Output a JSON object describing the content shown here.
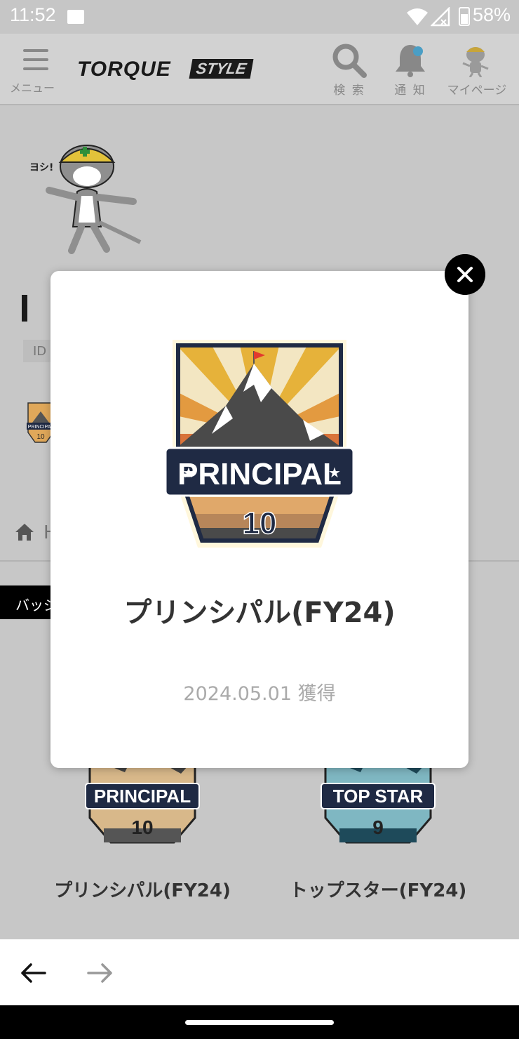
{
  "status_bar": {
    "time": "11:52",
    "battery": "58%"
  },
  "header": {
    "menu_label": "メニュー",
    "logo_main": "TORQUE",
    "logo_sub": "STYLE",
    "search_label": "検 索",
    "notify_label": "通 知",
    "mypage_label": "マイページ"
  },
  "profile": {
    "cat_caption": "ヨシ!",
    "id_label": "ID",
    "home_partial": "H"
  },
  "tabs": {
    "badge_tab_partial": "バッジ"
  },
  "badges": [
    {
      "title": "プリンシパル(FY24)",
      "ribbon": "PRINCIPAL",
      "number": "10"
    },
    {
      "title": "トップスター(FY24)",
      "ribbon": "TOP STAR",
      "number": "9"
    }
  ],
  "modal": {
    "ribbon": "PRINCIPAL",
    "number": "10",
    "title": "プリンシパル(FY24)",
    "date": "2024.05.01 獲得"
  },
  "colors": {
    "overlay_header": "#d2d2d2",
    "overlay_content": "#c7c7c7",
    "badge_navy": "#1f2a44",
    "badge_gold": "#e8b84a",
    "badge_teal": "#3f8fa0"
  }
}
